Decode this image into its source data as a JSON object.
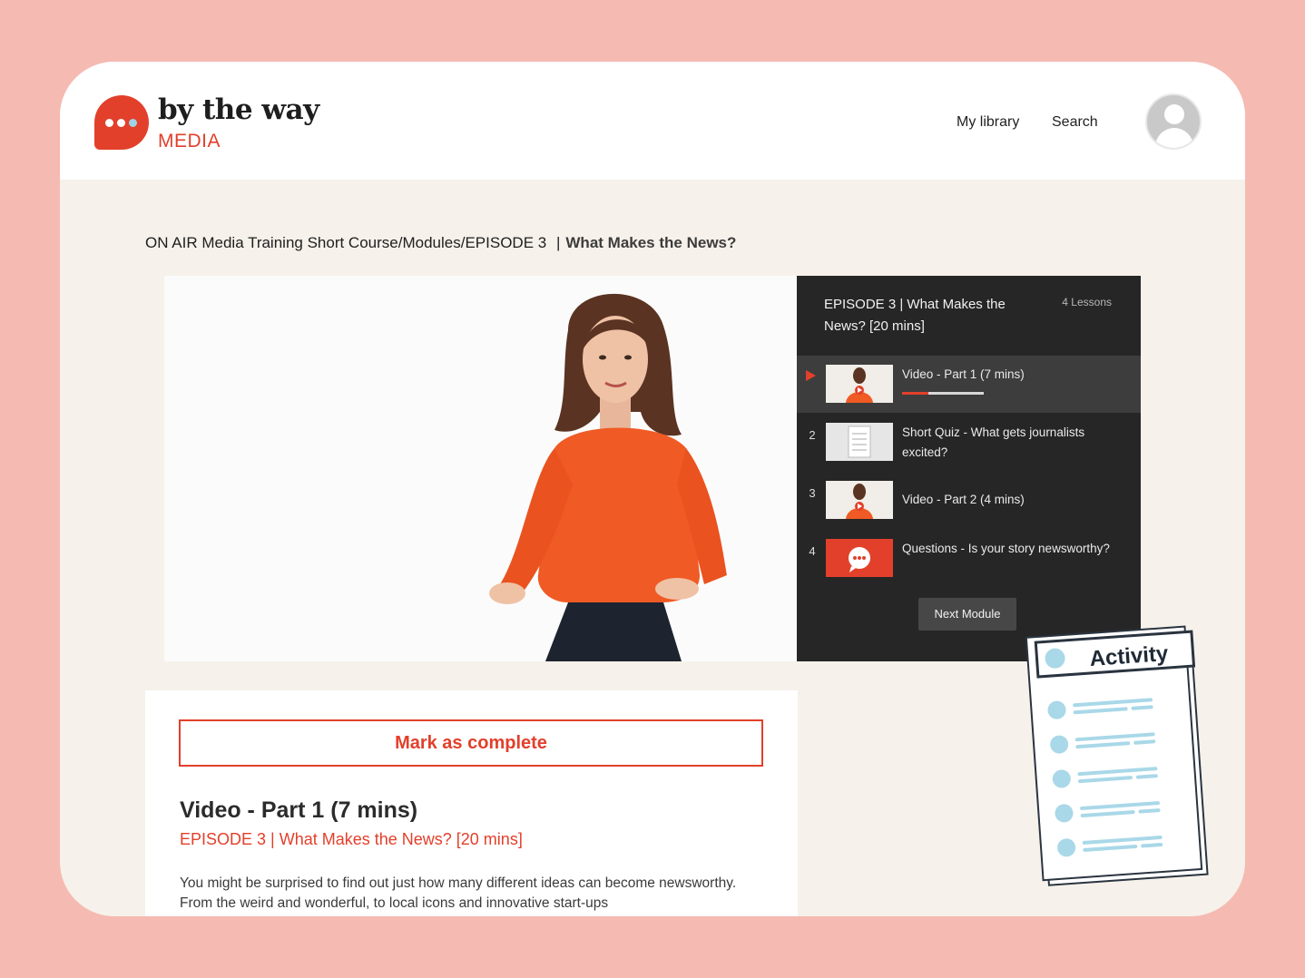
{
  "brand": {
    "name": "by the way",
    "sub": "MEDIA",
    "accent_color": "#e2402b",
    "background_color": "#f5bab2"
  },
  "nav": {
    "my_library": "My library",
    "search": "Search",
    "avatar_icon": "user-avatar-icon"
  },
  "breadcrumb": {
    "course": "ON AIR Media Training Short Course",
    "separator": "/",
    "modules": "Modules",
    "episode": "EPISODE 3",
    "pipe": "|",
    "current": "What Makes the News?"
  },
  "playlist": {
    "title": "EPISODE 3 | What Makes the News? [20 mins]",
    "count": "4 Lessons",
    "items": [
      {
        "num": "",
        "label": "Video - Part 1 (7 mins)",
        "thumb": "video",
        "active": true,
        "progress": 0.32
      },
      {
        "num": "2",
        "label": "Short Quiz - What gets journalists excited?",
        "thumb": "quiz",
        "active": false
      },
      {
        "num": "3",
        "label": "Video - Part 2 (4 mins)",
        "thumb": "video",
        "active": false
      },
      {
        "num": "4",
        "label": "Questions - Is your story newsworthy?",
        "thumb": "chat",
        "active": false
      }
    ],
    "next_button": "Next Module"
  },
  "lesson": {
    "mark_complete": "Mark as complete",
    "title": "Video - Part 1 (7 mins)",
    "episode": "EPISODE 3 | What Makes the News? [20 mins]",
    "description": "You might be surprised to find out just how many different ideas can become newsworthy. From the weird and wonderful, to local icons and innovative start-ups"
  },
  "activity_card": {
    "label": "Activity"
  }
}
